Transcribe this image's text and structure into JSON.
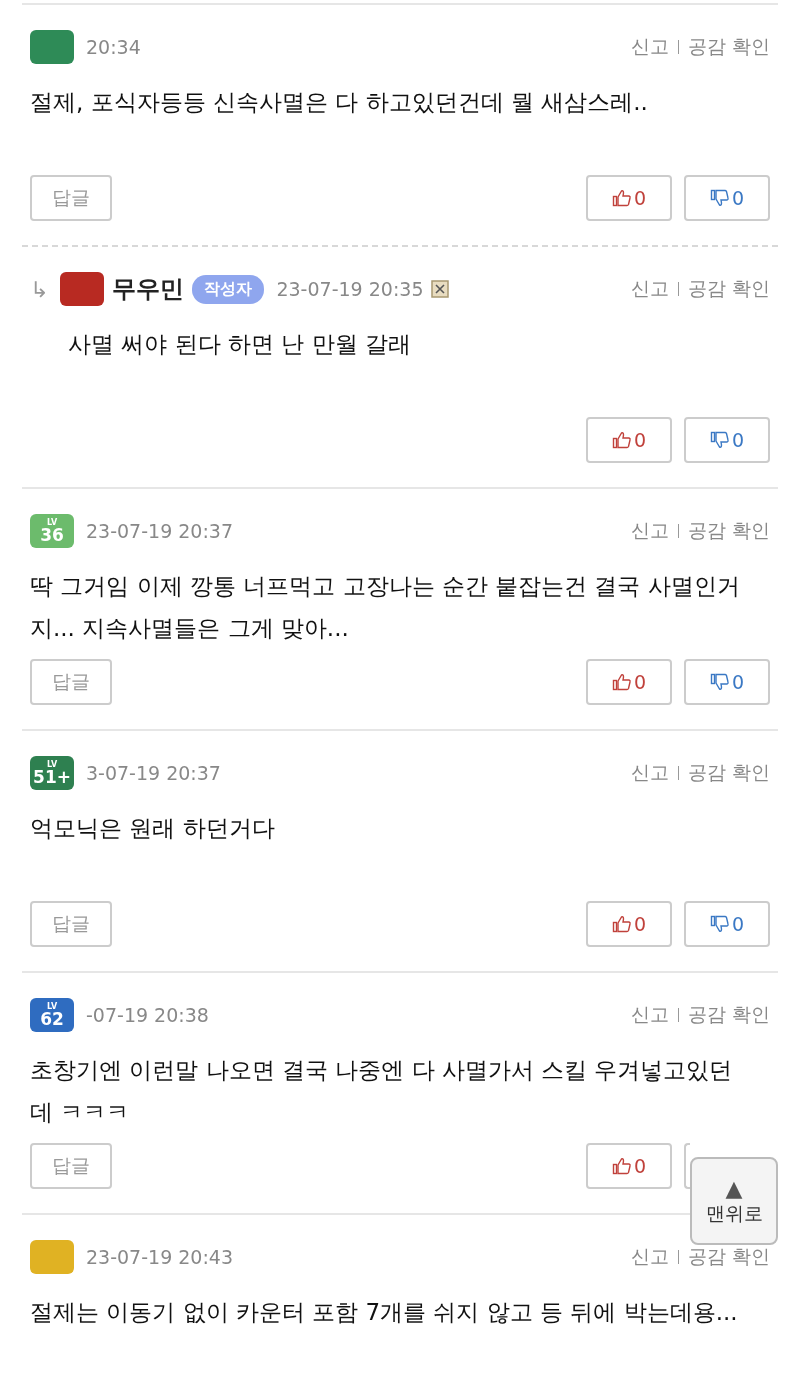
{
  "comments": [
    {
      "reply": false,
      "color": "#2e8b57",
      "date": "20:34",
      "author": false,
      "report_icon": false,
      "actions": [
        "신고",
        "공감 확인"
      ],
      "body": "절제, 포식자등등 신속사멸은 다 하고있던건데 뭘 새삼스레..",
      "reply_button": "답글",
      "likes": "0",
      "dislikes": "0"
    },
    {
      "reply": true,
      "reply_arrow": "↳",
      "color": "#b82a22",
      "name": "무우민",
      "author_tag": "작성자",
      "author": true,
      "date": "23-07-19 20:35",
      "report_icon": true,
      "actions": [
        "신고",
        "공감 확인"
      ],
      "body": "사멸 써야 된다 하면 난 만월 갈래",
      "likes": "0",
      "dislikes": "0"
    },
    {
      "reply": false,
      "color": "#6cbb6c",
      "level_prefix": "LV",
      "level": "36",
      "date": "23-07-19 20:37",
      "author": false,
      "report_icon": false,
      "actions": [
        "신고",
        "공감 확인"
      ],
      "body": "딱 그거임 이제 깡통 너프먹고 고장나는 순간 붙잡는건 결국 사멸인거지... 지속사멸들은 그게 맞아...",
      "reply_button": "답글",
      "likes": "0",
      "dislikes": "0"
    },
    {
      "reply": false,
      "color": "#2e8050",
      "level_prefix": "LV",
      "level": "51+",
      "date": "3-07-19 20:37",
      "author": false,
      "report_icon": false,
      "actions": [
        "신고",
        "공감 확인"
      ],
      "body": "억모닉은 원래 하던거다",
      "reply_button": "답글",
      "likes": "0",
      "dislikes": "0"
    },
    {
      "reply": false,
      "color": "#2f6cc0",
      "level_prefix": "LV",
      "level": "62",
      "date": "-07-19 20:38",
      "author": false,
      "report_icon": false,
      "actions": [
        "신고",
        "공감 확인"
      ],
      "body": "초창기엔 이런말 나오면 결국 나중엔 다 사멸가서 스킬 우겨넣고있던데 ㅋㅋㅋ",
      "reply_button": "답글",
      "likes": "0"
    },
    {
      "reply": false,
      "color": "#e0b223",
      "date": "23-07-19 20:43",
      "author": false,
      "report_icon": false,
      "actions": [
        "신고",
        "공감 확인"
      ],
      "body": "절제는 이동기 없이 카운터 포함 7개를 쉬지 않고 등 뒤에 박는데용..."
    }
  ],
  "scroll_top": {
    "arrow": "▲",
    "label": "맨위로"
  }
}
